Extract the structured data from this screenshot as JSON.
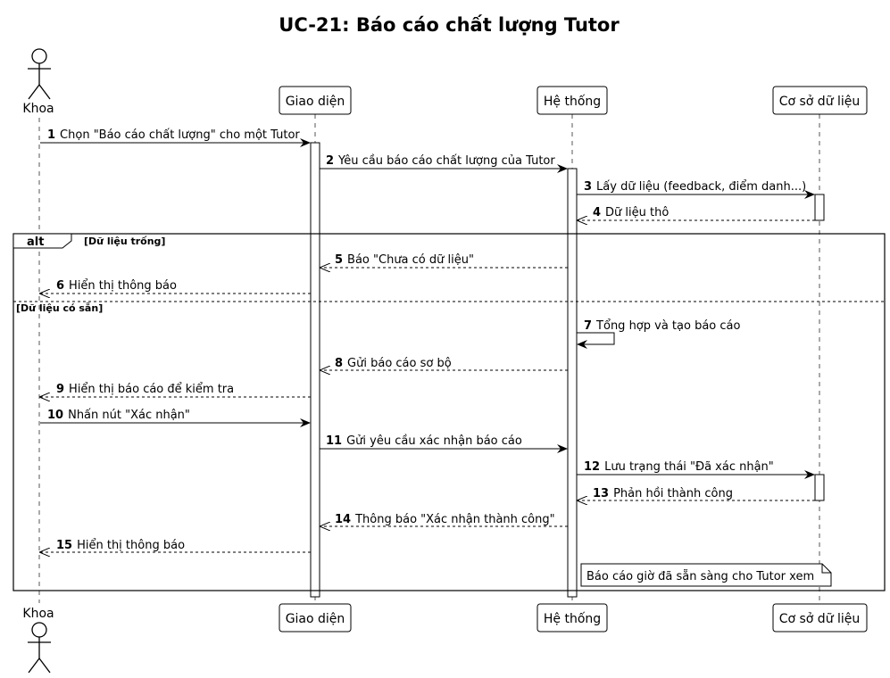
{
  "title": "UC-21: Báo cáo chất lượng Tutor",
  "participants": {
    "khoa": "Khoa",
    "giao_dien": "Giao diện",
    "he_thong": "Hệ thống",
    "csdl": "Cơ sở dữ liệu"
  },
  "messages": [
    {
      "num": "1",
      "text": "Chọn \"Báo cáo chất lượng\" cho một Tutor"
    },
    {
      "num": "2",
      "text": "Yêu cầu báo cáo chất lượng của Tutor"
    },
    {
      "num": "3",
      "text": "Lấy dữ liệu (feedback, điểm danh...)"
    },
    {
      "num": "4",
      "text": "Dữ liệu thô"
    },
    {
      "num": "5",
      "text": "Báo \"Chưa có dữ liệu\""
    },
    {
      "num": "6",
      "text": "Hiển thị thông báo"
    },
    {
      "num": "7",
      "text": "Tổng hợp và tạo báo cáo"
    },
    {
      "num": "8",
      "text": "Gửi báo cáo sơ bộ"
    },
    {
      "num": "9",
      "text": "Hiển thị báo cáo để kiểm tra"
    },
    {
      "num": "10",
      "text": "Nhấn nút \"Xác nhận\""
    },
    {
      "num": "11",
      "text": "Gửi yêu cầu xác nhận báo cáo"
    },
    {
      "num": "12",
      "text": "Lưu trạng thái \"Đã xác nhận\""
    },
    {
      "num": "13",
      "text": "Phản hồi thành công"
    },
    {
      "num": "14",
      "text": "Thông báo \"Xác nhận thành công\""
    },
    {
      "num": "15",
      "text": "Hiển thị thông báo"
    }
  ],
  "alt": {
    "keyword": "alt",
    "guard1": "[Dữ liệu trống]",
    "guard2": "[Dữ liệu có sẵn]"
  },
  "note": "Báo cáo giờ đã sẵn sàng cho Tutor xem"
}
